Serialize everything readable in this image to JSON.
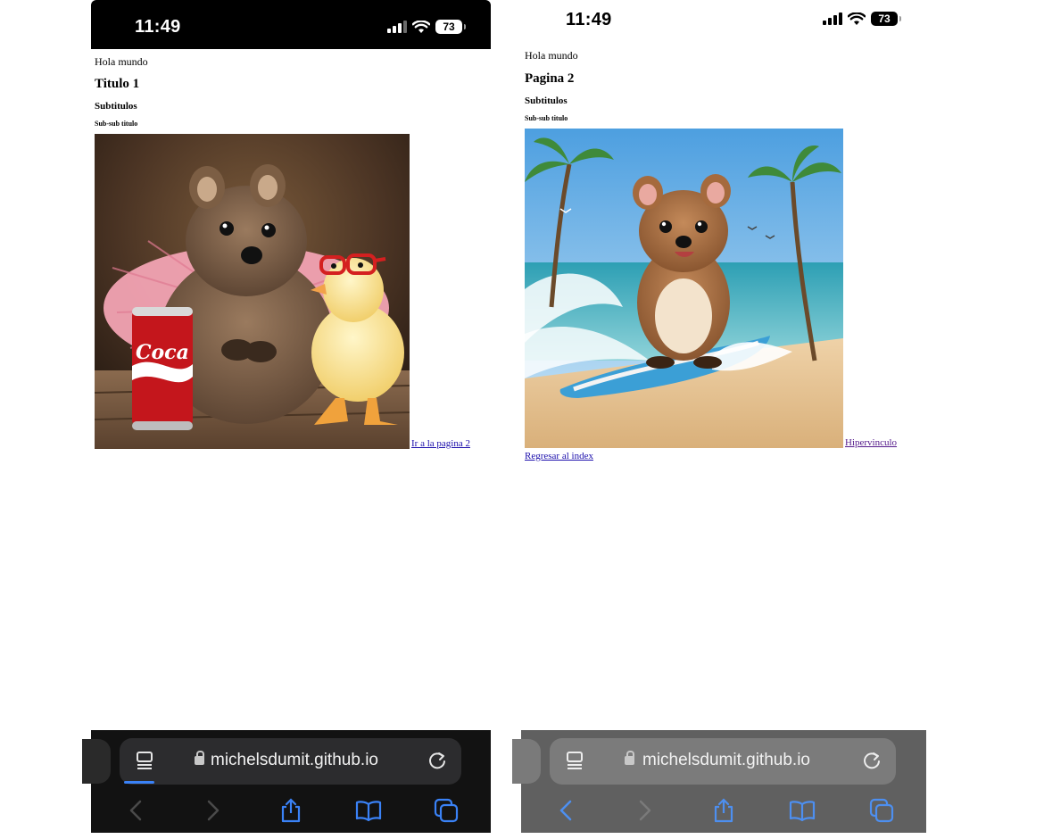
{
  "left": {
    "status": {
      "time": "11:49",
      "battery": "73"
    },
    "page": {
      "paragraph": "Hola mundo",
      "heading1": "Titulo 1",
      "heading3": "Subtitulos",
      "heading5": "Sub-sub titulo",
      "image_alt": "quokka with duck and cola can",
      "link": "Ir a la pagina 2"
    },
    "url": "michelsdumit.github.io"
  },
  "right": {
    "status": {
      "time": "11:49",
      "battery": "73"
    },
    "page": {
      "paragraph": "Hola mundo",
      "heading1": "Pagina 2",
      "heading3": "Subtitulos",
      "heading5": "Sub-sub titulo",
      "image_alt": "quokka surfing on beach",
      "link": "Hipervinculo",
      "link_back": "Regresar al index"
    },
    "url": "michelsdumit.github.io"
  },
  "icons": {
    "signal": "signal-icon",
    "wifi": "wifi-icon",
    "battery": "battery-icon",
    "reader": "reader-mode-icon",
    "lock": "lock-icon",
    "reload": "reload-icon",
    "back": "back-arrow-icon",
    "forward": "forward-arrow-icon",
    "share": "share-icon",
    "bookmarks": "bookmarks-icon",
    "tabs": "tabs-icon"
  },
  "colors": {
    "link": "#1a0dab",
    "visited_link": "#551a8b",
    "toolbar_accent": "#3a82f7"
  }
}
